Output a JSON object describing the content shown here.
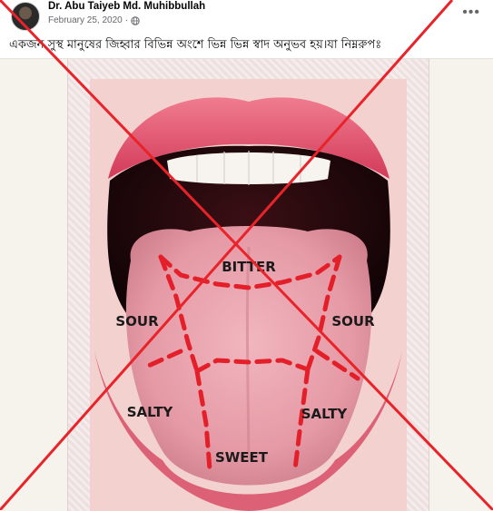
{
  "post": {
    "author": "Dr. Abu Taiyeb Md. Muhibbullah",
    "date": "February 25, 2020",
    "separator": "·",
    "text": "একজন সুস্থ মানুষের জিহ্বার বিভিন্ন অংশে ভিন্ন ভিন্ন স্বাদ অনুভব হয়।যা নিম্নরুপঃ",
    "more_label": "•••"
  },
  "icons": {
    "privacy": "globe-icon",
    "menu": "more-options-icon",
    "overlay": "red-x-cross"
  },
  "tongue_labels": {
    "bitter": "BITTER",
    "sour_left": "SOUR",
    "sour_right": "SOUR",
    "salty_left": "SALTY",
    "salty_right": "SALTY",
    "sweet": "SWEET"
  },
  "colors": {
    "cross": "#e8232a",
    "dashes": "#e3202a",
    "lips": "#e04a63",
    "tongue": "#e99aa6"
  }
}
